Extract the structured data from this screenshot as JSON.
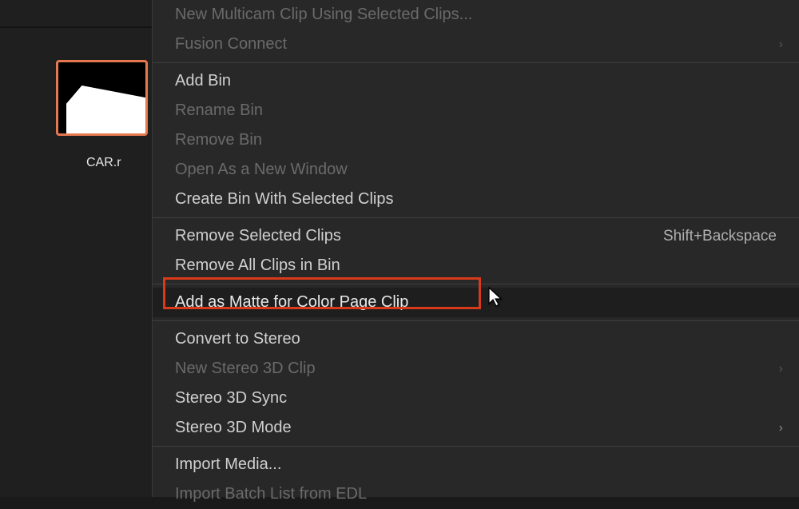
{
  "clip": {
    "label": "CAR.r"
  },
  "menu": {
    "newMulticam": "New Multicam Clip Using Selected Clips...",
    "fusionConnect": "Fusion Connect",
    "addBin": "Add Bin",
    "renameBin": "Rename Bin",
    "removeBin": "Remove Bin",
    "openNewWindow": "Open As a New Window",
    "createBinSelected": "Create Bin With Selected Clips",
    "removeSelectedClips": "Remove Selected Clips",
    "removeSelectedClipsShortcut": "Shift+Backspace",
    "removeAllClips": "Remove All Clips in Bin",
    "addAsMatte": "Add as Matte for Color Page Clip",
    "convertStereo": "Convert to Stereo",
    "newStereo3D": "New Stereo 3D Clip",
    "stereo3DSync": "Stereo 3D Sync",
    "stereo3DMode": "Stereo 3D Mode",
    "importMedia": "Import Media...",
    "importBatchEDL": "Import Batch List from EDL"
  }
}
